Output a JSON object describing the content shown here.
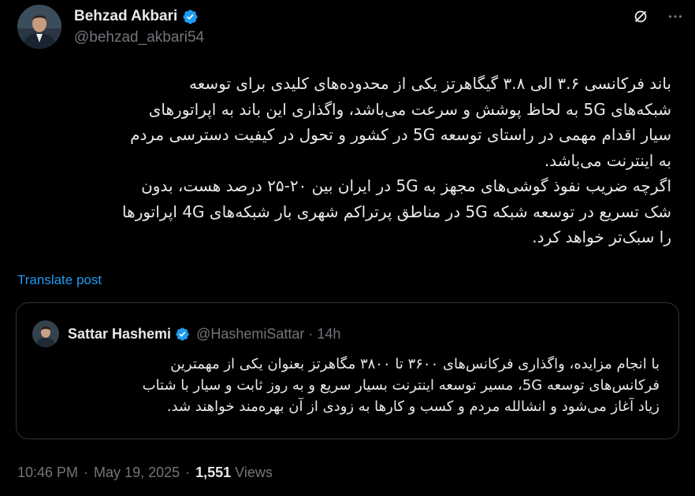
{
  "author": {
    "display_name": "Behzad Akbari",
    "handle": "@behzad_akbari54"
  },
  "tweet": {
    "text": "باند فرکانسی ۳.۶ الی ۳.۸ گیگاهرتز یکی از محدوده‌های کلیدی برای توسعه\nشبکه‌های 5G به لحاظ پوشش و سرعت می‌باشد، واگذاری این باند به اپراتورهای\nسیار اقدام مهمی در راستای توسعه 5G در کشور و تحول در کیفیت دسترسی مردم\nبه اینترنت می‌باشد.\nاگرچه ضریب نفوذ گوشی‌های مجهز به 5G در ایران بین ۲۰-۲۵ درصد هست، بدون\nشک تسریع در توسعه شبکه 5G در مناطق پرتراکم شهری بار شبکه‌های 4G اپراتورها\nرا سبک‌تر خواهد کرد.",
    "translate_label": "Translate post"
  },
  "quote": {
    "display_name": "Sattar Hashemi",
    "meta": "@HashemiSattar · 14h",
    "text": "با انجام مزایده، واگذاری فرکانس‌های ۳۶۰۰ تا ۳۸۰۰ مگاهرتز بعنوان یکی از مهمترین\nفرکانس‌های توسعه 5G، مسیر توسعه اینترنت بسیار سریع و به روز ثابت و سیار با شتاب\nزیاد آغاز می‌شود و انشالله مردم و کسب و کارها به زودی از آن بهره‌مند خواهند شد."
  },
  "footer": {
    "time": "10:46 PM",
    "date": "May 19, 2025",
    "views_count": "1,551",
    "views_label": "Views"
  },
  "icons": {
    "verified": "verified-badge-icon",
    "grok": "grok-icon",
    "more": "more-icon"
  },
  "colors": {
    "background": "#000000",
    "text": "#e7e9ea",
    "secondary": "#71767b",
    "accent": "#1d9bf0",
    "border": "#2f3336"
  }
}
